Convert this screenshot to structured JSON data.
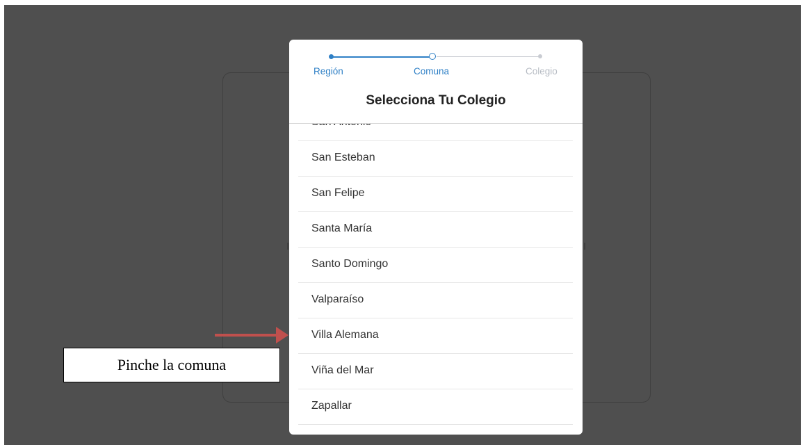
{
  "stepper": {
    "steps": [
      {
        "label": "Región",
        "state": "completed"
      },
      {
        "label": "Comuna",
        "state": "current"
      },
      {
        "label": "Colegio",
        "state": "pending"
      }
    ],
    "active_color": "#2f80c6",
    "inactive_color": "#b7bcc4"
  },
  "modal": {
    "title": "Selecciona Tu Colegio"
  },
  "list": {
    "items": [
      "San Antonio",
      "San Esteban",
      "San Felipe",
      "Santa María",
      "Santo Domingo",
      "Valparaíso",
      "Villa Alemana",
      "Viña del Mar",
      "Zapallar"
    ]
  },
  "annotation": {
    "callout_text": "Pinche la comuna",
    "arrow_color": "#c0504d"
  }
}
